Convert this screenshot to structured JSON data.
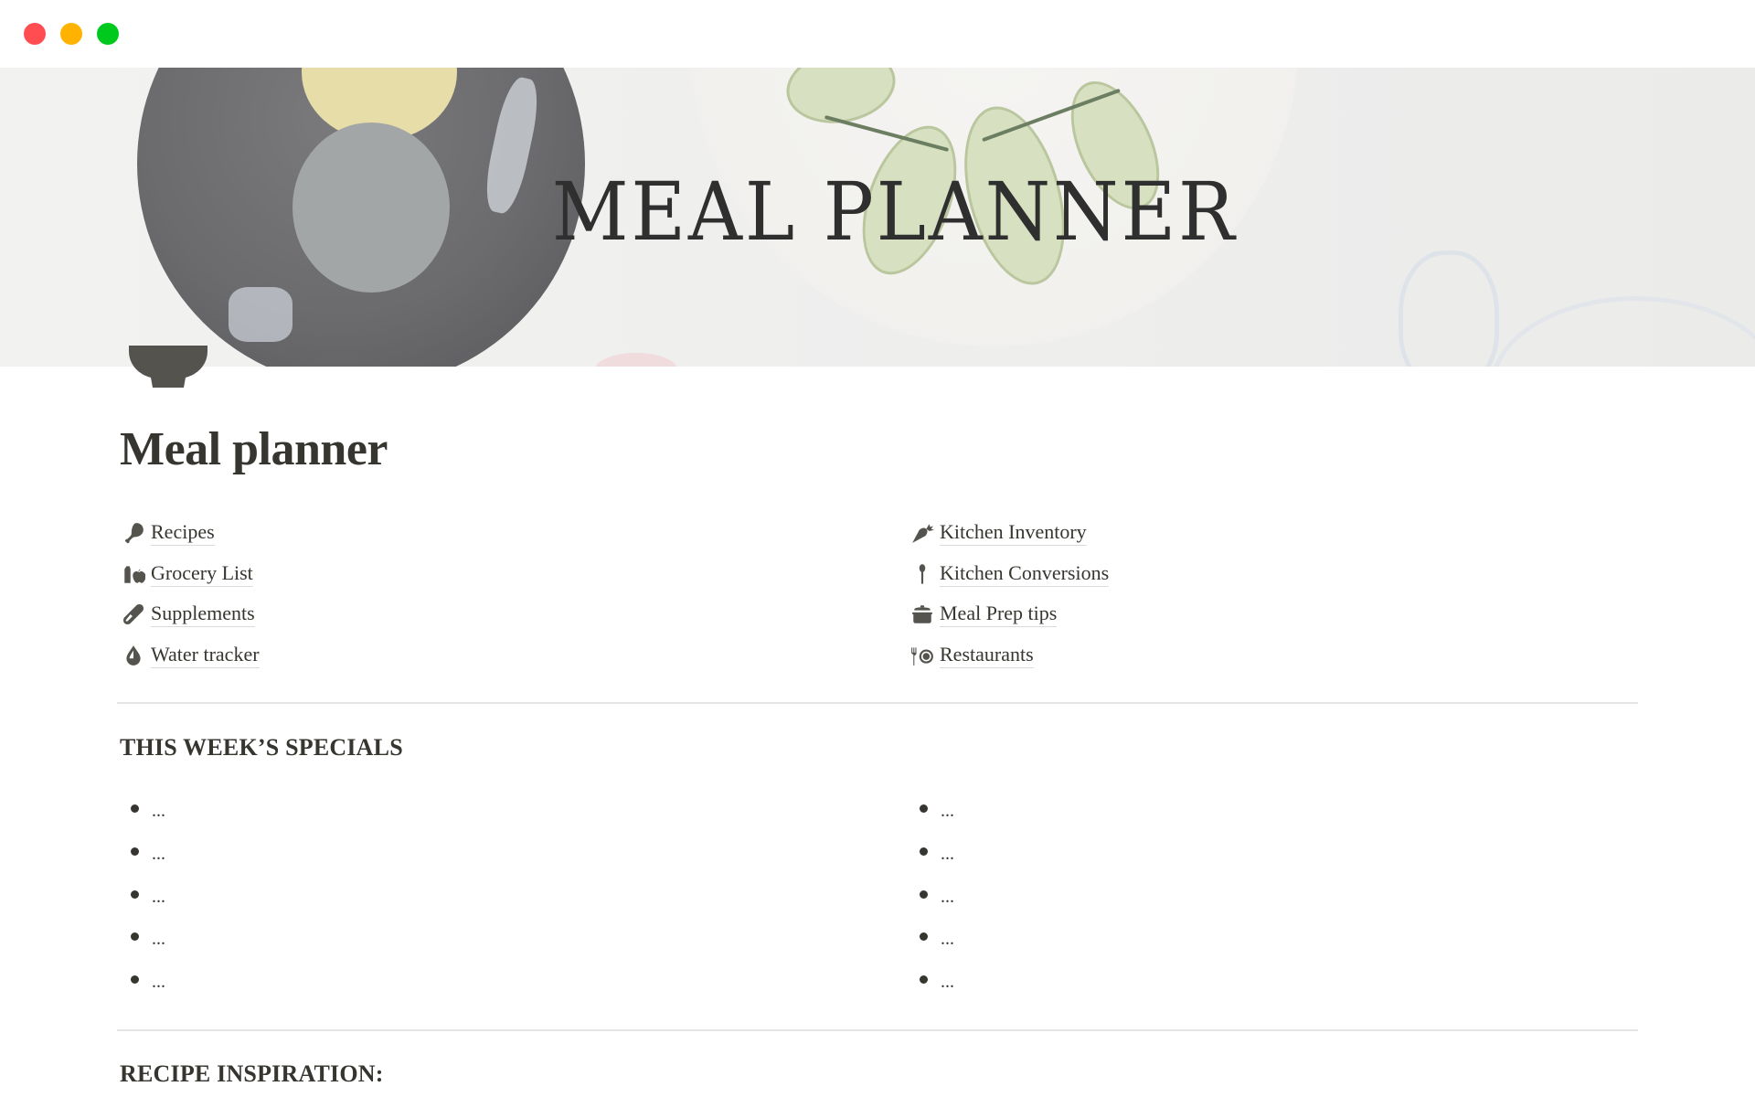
{
  "window": {
    "controls": [
      "close",
      "minimize",
      "maximize"
    ],
    "colors": {
      "close": "#ff4d52",
      "minimize": "#ffb200",
      "maximize": "#00c91e"
    }
  },
  "cover": {
    "title": "MEAL PLANNER",
    "image": "meal-plates-photo"
  },
  "page": {
    "icon": "bowl-icon",
    "title": "Meal planner"
  },
  "links": {
    "left": [
      {
        "label": "Recipes",
        "icon": "drumstick-icon"
      },
      {
        "label": "Grocery List",
        "icon": "grocery-icon"
      },
      {
        "label": "Supplements",
        "icon": "pill-icon"
      },
      {
        "label": "Water tracker",
        "icon": "water-drop-icon"
      }
    ],
    "right": [
      {
        "label": "Kitchen Inventory",
        "icon": "carrot-icon"
      },
      {
        "label": "Kitchen Conversions",
        "icon": "spoon-icon"
      },
      {
        "label": "Meal Prep tips",
        "icon": "pot-icon"
      },
      {
        "label": "Restaurants",
        "icon": "fork-plate-icon"
      }
    ]
  },
  "specials": {
    "heading": "THIS WEEK’S SPECIALS",
    "left": [
      "...",
      "...",
      "...",
      "...",
      "..."
    ],
    "right": [
      "...",
      "...",
      "...",
      "...",
      "..."
    ]
  },
  "inspiration": {
    "heading": "RECIPE INSPIRATION:"
  }
}
